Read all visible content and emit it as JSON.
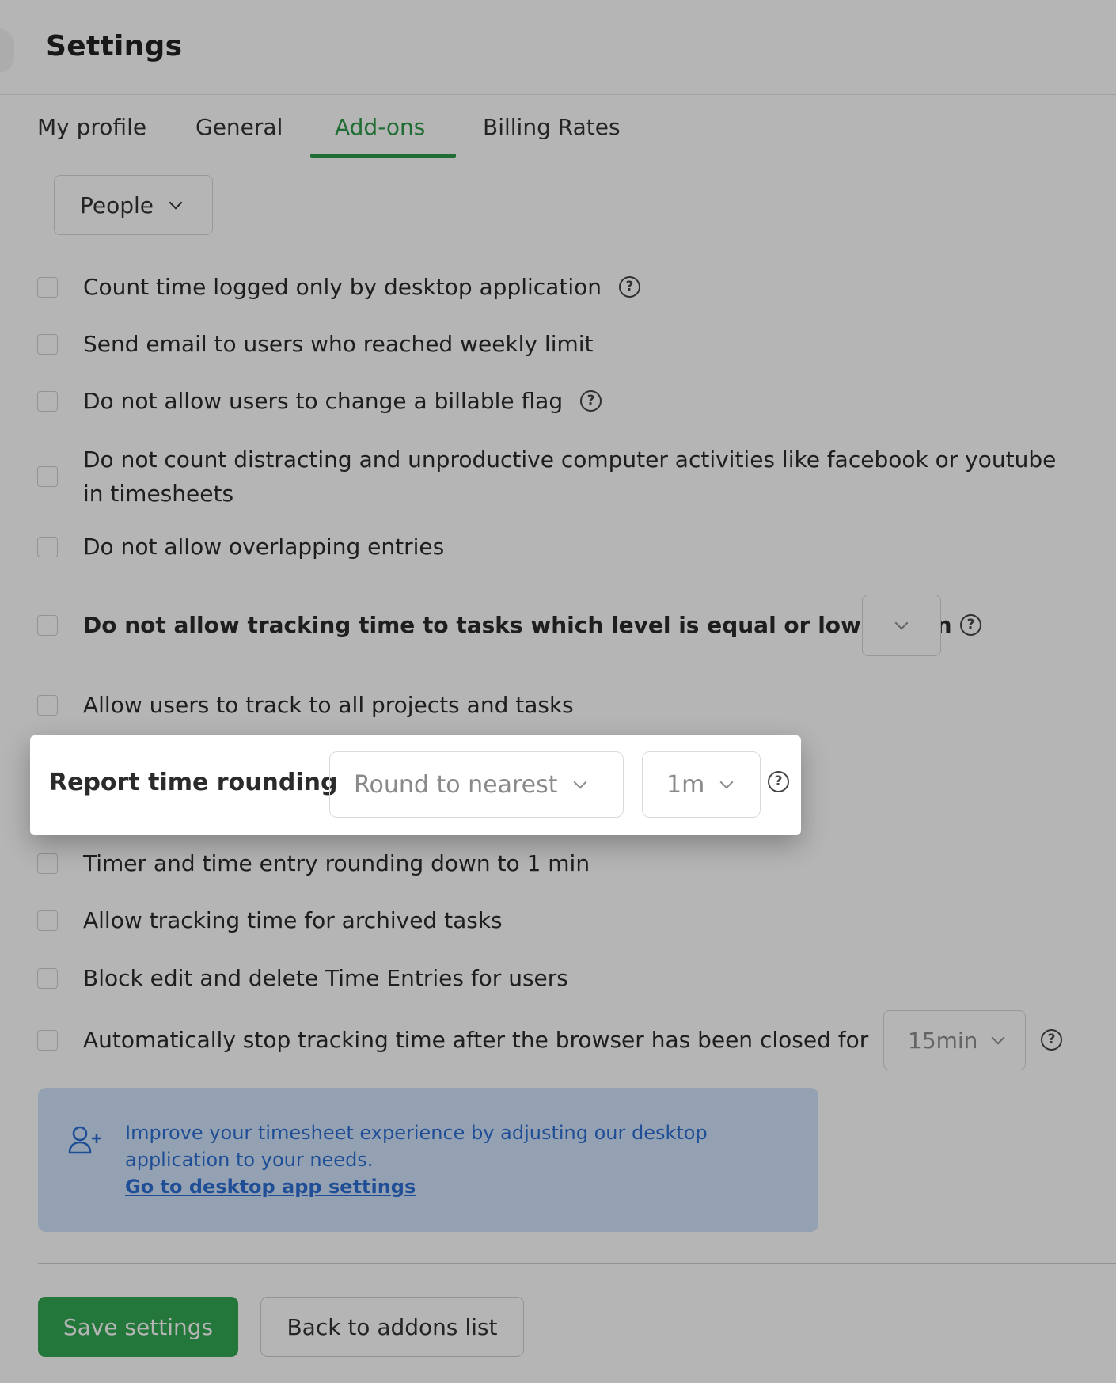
{
  "header": {
    "title": "Settings"
  },
  "tabs": [
    {
      "label": "My profile"
    },
    {
      "label": "General"
    },
    {
      "label": "Add-ons",
      "active": true
    },
    {
      "label": "Billing Rates"
    }
  ],
  "filter": {
    "selected": "People"
  },
  "options": [
    {
      "label": "Count time logged only by desktop application",
      "checked": false,
      "help": true
    },
    {
      "label": "Send email to users who reached weekly limit",
      "checked": false
    },
    {
      "label": "Do not allow users to change a billable flag",
      "checked": false,
      "help": true
    },
    {
      "label": "Do not count distracting and unproductive computer activities like facebook or youtube",
      "label2": "in timesheets",
      "checked": false
    },
    {
      "label": "Do not allow overlapping entries",
      "checked": false
    },
    {
      "label": "Do not allow tracking time to tasks which level is equal or lower than",
      "checked": false,
      "select_value": "",
      "help": true
    },
    {
      "label": "Allow users to track to all projects and tasks",
      "checked": false
    },
    {
      "label": "Timer and time entry rounding down to 1 min",
      "checked": false
    },
    {
      "label": "Allow tracking time for archived tasks",
      "checked": false
    },
    {
      "label": "Block edit and delete Time Entries for users",
      "checked": false
    },
    {
      "label": "Automatically stop tracking time after the browser has been closed for",
      "checked": false,
      "select_value": "15min",
      "help": true
    }
  ],
  "rounding": {
    "label": "Report time rounding",
    "mode": "Round to nearest",
    "interval": "1m"
  },
  "info": {
    "line1": "Improve your timesheet experience by adjusting our desktop",
    "line2": "application to your needs.",
    "link": "Go to desktop app settings",
    "accent": "#2d6fd4"
  },
  "footer": {
    "save_label": "Save settings",
    "back_label": "Back to addons list"
  },
  "colors": {
    "primary": "#34a853",
    "active_tab": "#2e9a4a",
    "info_bg": "#cfe3fb"
  }
}
